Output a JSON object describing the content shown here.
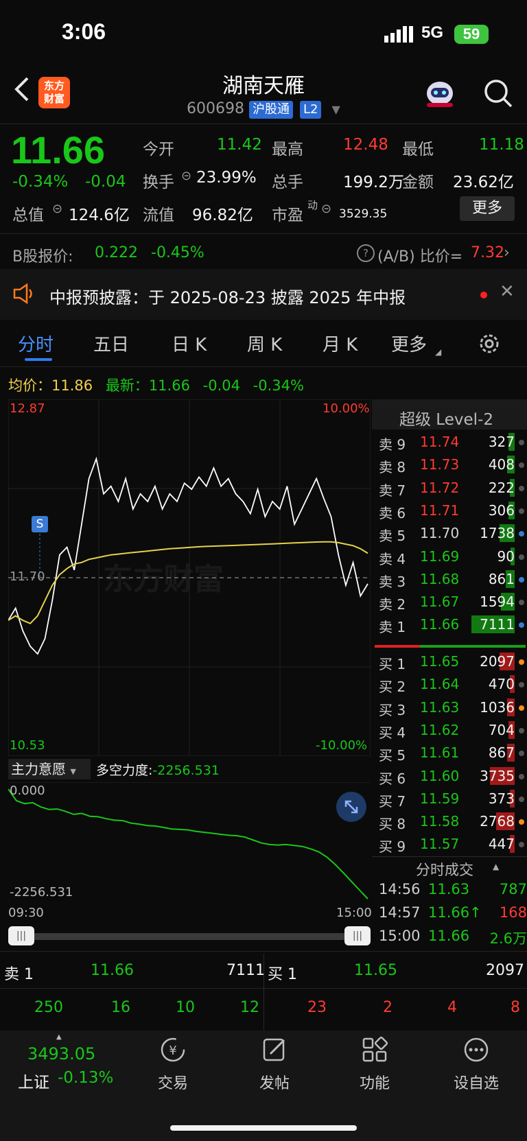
{
  "status_bar": {
    "time": "3:06",
    "network": "5G",
    "battery": "59"
  },
  "header": {
    "logo_text": "东方\n财富",
    "title": "湖南天雁",
    "code": "600698",
    "tag_connect": "沪股通",
    "tag_level": "L2"
  },
  "quote": {
    "price": "11.66",
    "change_pct": "-0.34%",
    "change": "-0.04",
    "open_label": "今开",
    "open": "11.42",
    "high_label": "最高",
    "high": "12.48",
    "low_label": "最低",
    "low": "11.18",
    "turnover_label": "换手",
    "turnover": "23.99%",
    "volume_label": "总手",
    "volume": "199.2万",
    "amount_label": "金额",
    "amount": "23.62亿",
    "mktcap_label": "总值",
    "mktcap": "124.6亿",
    "float_label": "流值",
    "float_cap": "96.82亿",
    "pe_label": "市盈",
    "pe_sup": "动",
    "pe": "3529.35",
    "more_label": "更多"
  },
  "bshare": {
    "label": "B股报价:",
    "price": "0.222",
    "change": "-0.45%",
    "ratio_label": "(A/B) 比价=",
    "ratio": "7.32"
  },
  "notice": {
    "text": "中报预披露：于 2025-08-23 披露 2025 年中报"
  },
  "tabs": [
    "分时",
    "五日",
    "日 K",
    "周 K",
    "月 K",
    "更多"
  ],
  "chart_header": {
    "avg_label": "均价：",
    "avg": "11.86",
    "latest_label": "最新：",
    "latest": "11.66",
    "chg": "-0.04",
    "chg_pct": "-0.34%"
  },
  "chart_data": {
    "type": "line",
    "y_max_label": "12.87",
    "y_min_label": "10.53",
    "pct_max_label": "10.00%",
    "pct_min_label": "-10.00%",
    "prev_close_label": "11.70",
    "ylim": [
      10.53,
      12.87
    ],
    "x_start": "09:30",
    "x_end": "15:00",
    "marker": "S",
    "series": [
      {
        "name": "price",
        "color": "#ffffff",
        "values": [
          11.42,
          11.5,
          11.35,
          11.25,
          11.2,
          11.3,
          11.55,
          11.85,
          11.9,
          11.75,
          12.05,
          12.35,
          12.48,
          12.25,
          12.3,
          12.2,
          12.35,
          12.15,
          12.25,
          12.2,
          12.3,
          12.15,
          12.25,
          12.2,
          12.32,
          12.28,
          12.36,
          12.3,
          12.42,
          12.3,
          12.35,
          12.25,
          12.2,
          12.12,
          12.28,
          12.1,
          12.2,
          12.15,
          12.3,
          12.05,
          12.15,
          12.25,
          12.35,
          12.22,
          12.1,
          11.85,
          11.65,
          11.8,
          11.58,
          11.66
        ]
      },
      {
        "name": "avg",
        "color": "#e6d24a",
        "values": [
          11.42,
          11.45,
          11.42,
          11.4,
          11.45,
          11.55,
          11.65,
          11.72,
          11.76,
          11.79,
          11.8,
          11.82,
          11.83,
          11.84,
          11.85,
          11.855,
          11.86,
          11.865,
          11.87,
          11.875,
          11.88,
          11.885,
          11.89,
          11.893,
          11.896,
          11.9,
          11.903,
          11.905,
          11.907,
          11.909,
          11.91,
          11.912,
          11.914,
          11.916,
          11.918,
          11.92,
          11.922,
          11.924,
          11.926,
          11.928,
          11.93,
          11.932,
          11.934,
          11.935,
          11.935,
          11.93,
          11.92,
          11.91,
          11.89,
          11.86
        ]
      }
    ]
  },
  "sub_chart": {
    "dropdown": "主力意愿",
    "label": "多空力度:",
    "value": "-2256.531",
    "top_label": "0.000",
    "bottom_label": "-2256.531",
    "values": [
      0,
      -240,
      -300,
      -280,
      -370,
      -420,
      -410,
      -460,
      -520,
      -500,
      -560,
      -570,
      -610,
      -640,
      -650,
      -700,
      -720,
      -750,
      -760,
      -790,
      -820,
      -830,
      -840,
      -870,
      -890,
      -910,
      -930,
      -950,
      -960,
      -990,
      -1050,
      -1110,
      -1140,
      -1150,
      -1140,
      -1160,
      -1180,
      -1230,
      -1290,
      -1400,
      -1550,
      -1720,
      -1900,
      -2080,
      -2256
    ]
  },
  "order_book": {
    "title": "超级 Level-2",
    "asks": [
      {
        "label": "卖 9",
        "price": "11.74",
        "vol": "327",
        "color": "#ff3b30",
        "bar": 0.04,
        "dot": "#555555"
      },
      {
        "label": "卖 8",
        "price": "11.73",
        "vol": "408",
        "color": "#ff3b30",
        "bar": 0.05,
        "dot": "#555555"
      },
      {
        "label": "卖 7",
        "price": "11.72",
        "vol": "222",
        "color": "#ff3b30",
        "bar": 0.03,
        "dot": "#555555"
      },
      {
        "label": "卖 6",
        "price": "11.71",
        "vol": "306",
        "color": "#ff3b30",
        "bar": 0.04,
        "dot": "#555555"
      },
      {
        "label": "卖 5",
        "price": "11.70",
        "vol": "1738",
        "color": "#d8d8d8",
        "bar": 0.1,
        "dot": "#3a7bd5"
      },
      {
        "label": "卖 4",
        "price": "11.69",
        "vol": "90",
        "color": "#19c719",
        "bar": 0.02,
        "dot": "#555555"
      },
      {
        "label": "卖 3",
        "price": "11.68",
        "vol": "861",
        "color": "#19c719",
        "bar": 0.06,
        "dot": "#3a7bd5"
      },
      {
        "label": "卖 2",
        "price": "11.67",
        "vol": "1594",
        "color": "#19c719",
        "bar": 0.09,
        "dot": "#555555"
      },
      {
        "label": "卖 1",
        "price": "11.66",
        "vol": "7111",
        "color": "#19c719",
        "bar": 0.28,
        "dot": "#3a7bd5"
      }
    ],
    "bids": [
      {
        "label": "买 1",
        "price": "11.65",
        "vol": "2097",
        "color": "#19c719",
        "bar": 0.1,
        "dot": "#ff8c1a"
      },
      {
        "label": "买 2",
        "price": "11.64",
        "vol": "470",
        "color": "#19c719",
        "bar": 0.03,
        "dot": "#555555"
      },
      {
        "label": "买 3",
        "price": "11.63",
        "vol": "1036",
        "color": "#19c719",
        "bar": 0.05,
        "dot": "#ff8c1a"
      },
      {
        "label": "买 4",
        "price": "11.62",
        "vol": "704",
        "color": "#19c719",
        "bar": 0.04,
        "dot": "#555555"
      },
      {
        "label": "买 5",
        "price": "11.61",
        "vol": "867",
        "color": "#19c719",
        "bar": 0.05,
        "dot": "#555555"
      },
      {
        "label": "买 6",
        "price": "11.60",
        "vol": "3735",
        "color": "#19c719",
        "bar": 0.16,
        "dot": "#555555"
      },
      {
        "label": "买 7",
        "price": "11.59",
        "vol": "373",
        "color": "#19c719",
        "bar": 0.03,
        "dot": "#555555"
      },
      {
        "label": "买 8",
        "price": "11.58",
        "vol": "2768",
        "color": "#19c719",
        "bar": 0.12,
        "dot": "#ff8c1a"
      },
      {
        "label": "买 9",
        "price": "11.57",
        "vol": "447",
        "color": "#19c719",
        "bar": 0.03,
        "dot": "#555555"
      }
    ]
  },
  "trades": {
    "title": "分时成交",
    "rows": [
      {
        "time": "14:56",
        "price": "11.63",
        "vol": "787",
        "vol_color": "#19c719"
      },
      {
        "time": "14:57",
        "price": "11.66↑",
        "vol": "168",
        "vol_color": "#ff3b30"
      },
      {
        "time": "15:00",
        "price": "11.66",
        "vol": "2.6万",
        "vol_color": "#19c719"
      }
    ]
  },
  "bottom_book": {
    "sell_label": "卖 1",
    "sell_price": "11.66",
    "sell_vol": "7111",
    "buy_label": "买 1",
    "buy_price": "11.65",
    "buy_vol": "2097",
    "sell_queue": [
      "250",
      "16",
      "10",
      "12"
    ],
    "buy_queue": [
      "23",
      "2",
      "4",
      "8"
    ]
  },
  "nav": {
    "index_value": "3493.05",
    "index_name": "上证",
    "index_change": "-0.13%",
    "items": [
      {
        "label": "交易",
        "icon": "yen-circle-icon"
      },
      {
        "label": "发帖",
        "icon": "edit-icon"
      },
      {
        "label": "功能",
        "icon": "grid-icon"
      },
      {
        "label": "设自选",
        "icon": "more-dots-icon"
      }
    ]
  }
}
